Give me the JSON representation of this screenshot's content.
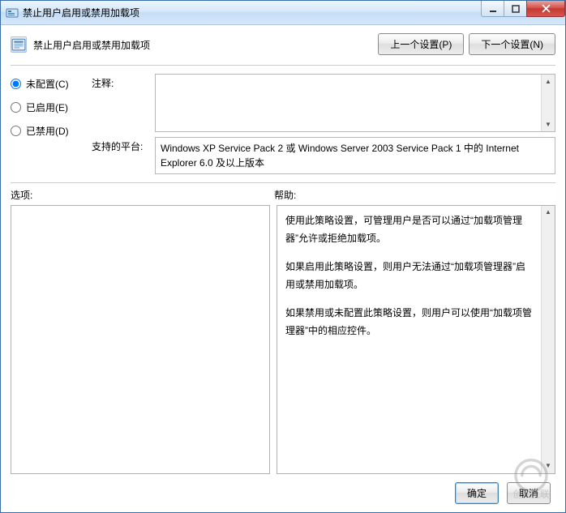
{
  "window": {
    "title": "禁止用户启用或禁用加载项"
  },
  "header": {
    "title": "禁止用户启用或禁用加载项",
    "prev_button": "上一个设置(P)",
    "next_button": "下一个设置(N)"
  },
  "state": {
    "not_configured": "未配置(C)",
    "enabled": "已启用(E)",
    "disabled": "已禁用(D)",
    "selected": "not_configured"
  },
  "labels": {
    "comment": "注释:",
    "supported_on": "支持的平台:",
    "options": "选项:",
    "help": "帮助:"
  },
  "supported_on": "Windows XP Service Pack 2 或 Windows Server 2003 Service Pack 1 中的 Internet Explorer 6.0 及以上版本",
  "help": {
    "p1": "使用此策略设置，可管理用户是否可以通过“加载项管理器”允许或拒绝加载项。",
    "p2": "如果启用此策略设置，则用户无法通过“加载项管理器”启用或禁用加载项。",
    "p3": "如果禁用或未配置此策略设置，则用户可以使用“加载项管理器”中的相应控件。"
  },
  "footer": {
    "ok": "确定",
    "cancel": "取消"
  },
  "watermark": "创新互联"
}
